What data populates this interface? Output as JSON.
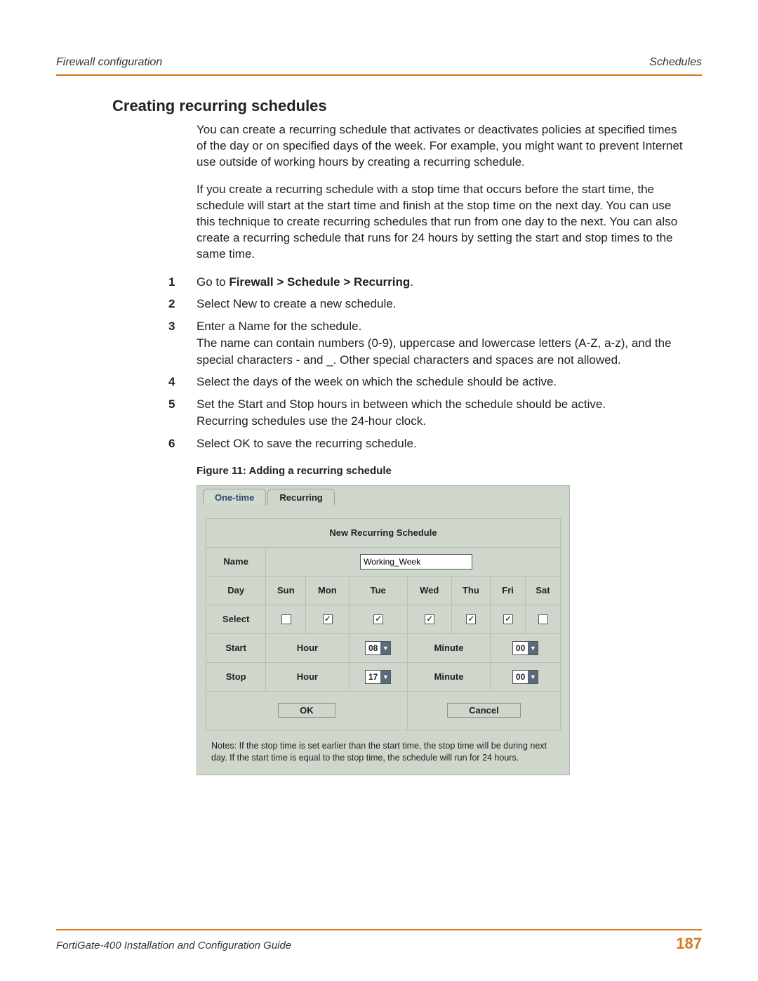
{
  "header": {
    "left": "Firewall configuration",
    "right": "Schedules"
  },
  "section_title": "Creating recurring schedules",
  "intro_paragraphs": [
    "You can create a recurring schedule that activates or deactivates policies at specified times of the day or on specified days of the week. For example, you might want to prevent Internet use outside of working hours by creating a recurring schedule.",
    "If you create a recurring schedule with a stop time that occurs before the start time, the schedule will start at the start time and finish at the stop time on the next day. You can use this technique to create recurring schedules that run from one day to the next. You can also create a recurring schedule that runs for 24 hours by setting the start and stop times to the same time."
  ],
  "steps": {
    "s1_prefix": "Go to ",
    "s1_bold": "Firewall > Schedule > Recurring",
    "s1_suffix": ".",
    "s2": "Select New to create a new schedule.",
    "s3a": "Enter a Name for the schedule.",
    "s3b": "The name can contain numbers (0-9), uppercase and lowercase letters (A-Z, a-z), and the special characters - and _. Other special characters and spaces are not allowed.",
    "s4": "Select the days of the week on which the schedule should be active.",
    "s5a": "Set the Start and Stop hours in between which the schedule should be active.",
    "s5b": "Recurring schedules use the 24-hour clock.",
    "s6": "Select OK to save the recurring schedule."
  },
  "figure_caption": "Figure 11: Adding a recurring schedule",
  "screenshot": {
    "tabs": {
      "onetime": "One-time",
      "recurring": "Recurring"
    },
    "panel_title": "New Recurring Schedule",
    "rows": {
      "name_label": "Name",
      "name_value": "Working_Week",
      "day_label": "Day",
      "select_label": "Select",
      "days": [
        "Sun",
        "Mon",
        "Tue",
        "Wed",
        "Thu",
        "Fri",
        "Sat"
      ],
      "checked": [
        false,
        true,
        true,
        true,
        true,
        true,
        false
      ],
      "start_label": "Start",
      "stop_label": "Stop",
      "hour_label": "Hour",
      "minute_label": "Minute",
      "start_hour": "08",
      "start_min": "00",
      "stop_hour": "17",
      "stop_min": "00"
    },
    "buttons": {
      "ok": "OK",
      "cancel": "Cancel"
    },
    "notes": "Notes: If the stop time is set earlier than the start time, the stop time will be during next day. If the start time is equal to the stop time, the schedule will run for 24 hours."
  },
  "footer": {
    "title": "FortiGate-400 Installation and Configuration Guide",
    "page": "187"
  }
}
